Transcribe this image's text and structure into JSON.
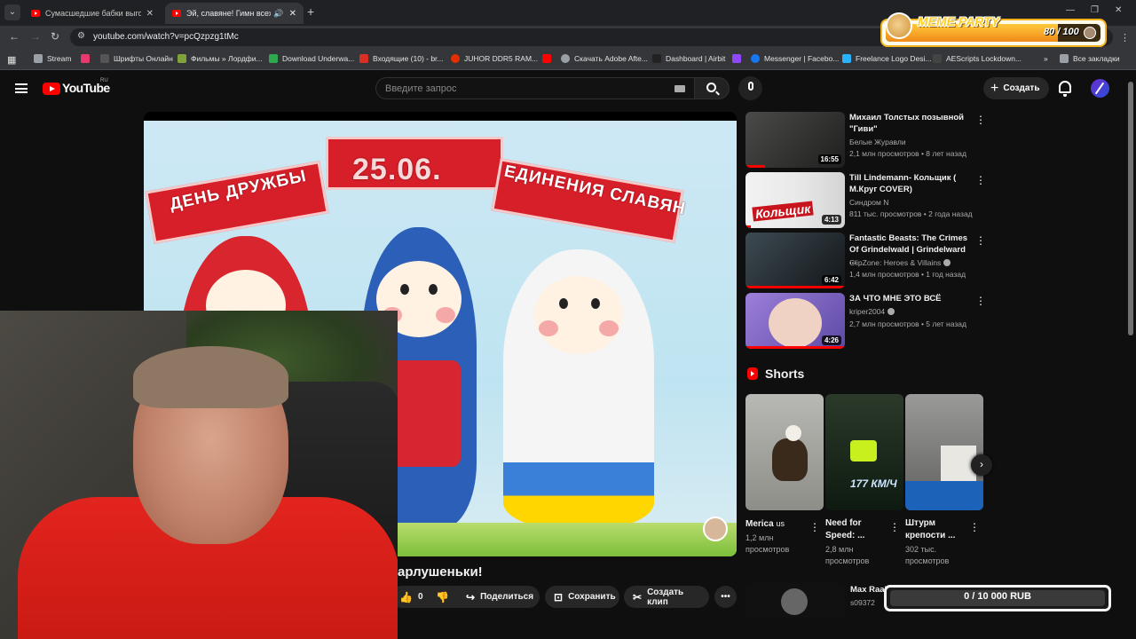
{
  "browser": {
    "tabs": [
      {
        "title": "Сумасшедшие бабки выгоняю",
        "active": false
      },
      {
        "title": "Эй, славяне! Гимн всех люде",
        "active": true
      }
    ],
    "new_tab": "+",
    "url": "youtube.com/watch?v=pcQzpzg1tMc",
    "bookmarks": [
      {
        "label": "Stream",
        "icon": "folder-icon",
        "color": "#9aa0a6"
      },
      {
        "label": "",
        "icon": "red-app-icon",
        "color": "#e8386d"
      },
      {
        "label": "Шрифты Онлайн",
        "icon": "font-icon",
        "color": "#555"
      },
      {
        "label": "Фильмы » Лордфи...",
        "icon": "film-icon",
        "color": "#7fa33b"
      },
      {
        "label": "Download Underwa...",
        "icon": "download-icon",
        "color": "#2fa84f"
      },
      {
        "label": "Входящие (10) - br...",
        "icon": "gmail-icon",
        "color": "#d93025"
      },
      {
        "label": "JUHOR DDR5 RAM...",
        "icon": "aliexpress-icon",
        "color": "#e62e04"
      },
      {
        "label": "",
        "icon": "youtube-icon",
        "color": "#ff0000"
      },
      {
        "label": "Скачать Adobe Afte...",
        "icon": "globe-icon",
        "color": "#9aa0a6"
      },
      {
        "label": "Dashboard | Airbit",
        "icon": "airbit-icon",
        "color": "#222"
      },
      {
        "label": "",
        "icon": "twitch-icon",
        "color": "#9146ff"
      },
      {
        "label": "Messenger | Facebo...",
        "icon": "facebook-icon",
        "color": "#1877f2"
      },
      {
        "label": "Freelance Logo Desi...",
        "icon": "freelance-icon",
        "color": "#29b2fe"
      },
      {
        "label": "AEScripts Lockdown...",
        "icon": "aescripts-icon",
        "color": "#444"
      }
    ],
    "overflow": "»",
    "all_bookmarks": "Все закладки"
  },
  "youtube": {
    "logo": "YouTube",
    "country": "RU",
    "search_placeholder": "Введите запрос",
    "create_label": "Создать"
  },
  "video": {
    "banner_left": "ДЕНЬ ДРУЖБЫ",
    "banner_mid": "25.06.",
    "banner_right": "ЕДИНЕНИЯ СЛАВЯН",
    "title_visible": "арлушеньки!",
    "like_count": "0",
    "share_label": "Поделиться",
    "save_label": "Сохранить",
    "clip_label": "Создать клип"
  },
  "recommendations": [
    {
      "title": "Михаил Толстых позывной \"Гиви\"",
      "channel": "Белые Журавли",
      "verified": false,
      "meta": "2,1 млн просмотров • 8 лет назад",
      "duration": "16:55",
      "watched": 0.2
    },
    {
      "title": "Till Lindemann- Кольщик ( М.Круг COVER)",
      "channel": "Синдром N",
      "verified": false,
      "meta": "811 тыс. просмотров • 2 года назад",
      "duration": "4:13",
      "thumb_text": "Кольщик",
      "watched": 0.05
    },
    {
      "title": "Fantastic Beasts: The Crimes Of Grindelwald | Grindelward ...",
      "channel": "ClipZone: Heroes & Villains",
      "verified": true,
      "meta": "1,4 млн просмотров • 1 год назад",
      "duration": "6:42",
      "watched": 1
    },
    {
      "title": "ЗА ЧТО МНЕ ЭТО ВСЁ",
      "channel": "kriper2004",
      "verified": true,
      "meta": "2,7 млн просмотров • 5 лет назад",
      "duration": "4:26",
      "watched": 1
    }
  ],
  "shorts": {
    "heading": "Shorts",
    "items": [
      {
        "title": "Merica",
        "suffix": "us",
        "views": "1,2 млн просмотров"
      },
      {
        "title": "Need for Speed: ...",
        "suffix": "",
        "views": "2,8 млн просмотров",
        "thumb_text": "177 КМ/Ч"
      },
      {
        "title": "Штурм крепости ...",
        "suffix": "",
        "views": "302 тыс. просмотров"
      }
    ]
  },
  "partial_rec": {
    "title": "Max Raab",
    "channel": "s09372"
  },
  "overlay": {
    "meme_party_label": "MEME PARTY",
    "meme_party_count": "80 / 100",
    "meme_party_fraction": 0.8,
    "donation_text": "0 / 10 000 RUB"
  }
}
